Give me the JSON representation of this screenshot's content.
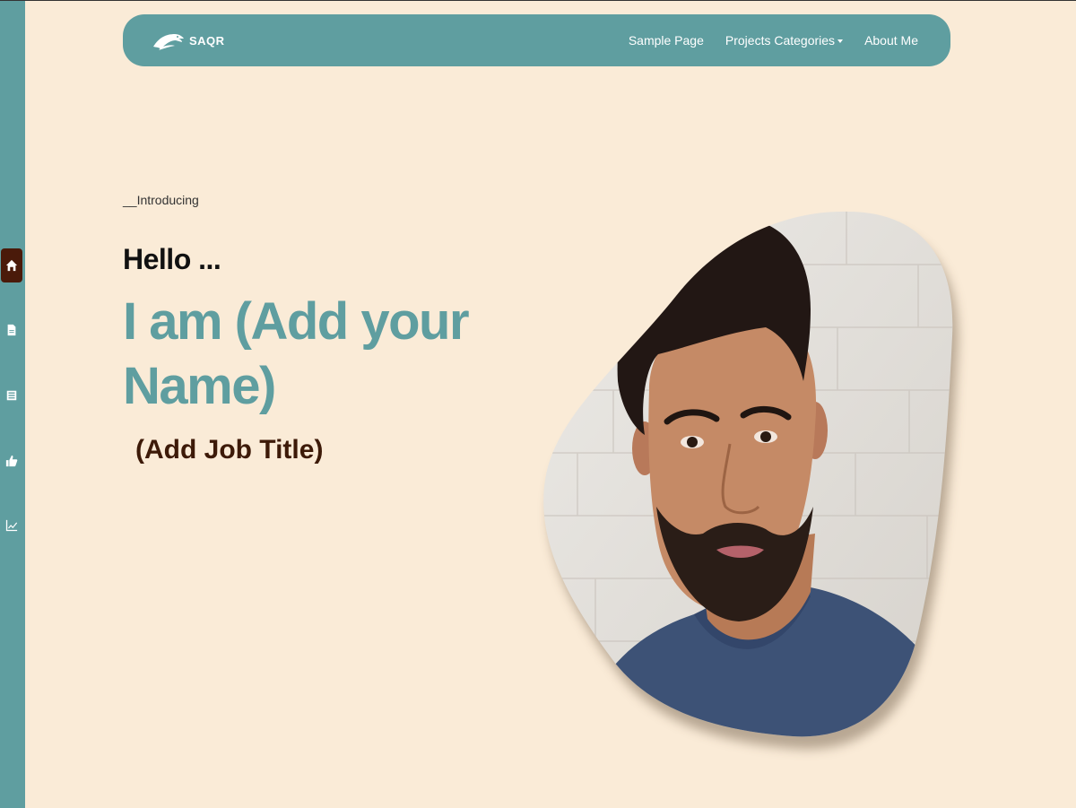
{
  "sidebar": {
    "items": [
      {
        "icon": "home-icon",
        "active": true
      },
      {
        "icon": "document-icon",
        "active": false
      },
      {
        "icon": "list-icon",
        "active": false
      },
      {
        "icon": "thumbs-up-icon",
        "active": false
      },
      {
        "icon": "chart-line-icon",
        "active": false
      }
    ]
  },
  "navbar": {
    "brand": "SAQR",
    "links": {
      "sample": "Sample Page",
      "projects": "Projects Categories",
      "about": "About Me"
    }
  },
  "hero": {
    "intro": "__Introducing",
    "hello": "Hello ...",
    "name": "I am (Add your Name)",
    "job_title": "(Add Job Title)"
  },
  "colors": {
    "background": "#faebd7",
    "accent": "#5f9ea0",
    "dark_brown": "#4a1a0a"
  }
}
